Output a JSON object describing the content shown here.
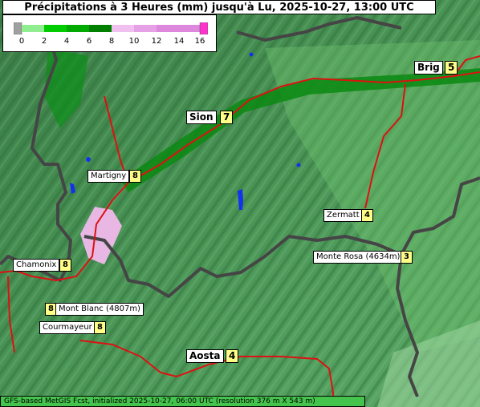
{
  "title": "Précipitations à 3 Heures (mm) jusqu'à Lu, 2025-10-27, 13:00 UTC",
  "legend": {
    "ticks": [
      "0",
      "2",
      "4",
      "6",
      "8",
      "10",
      "12",
      "14",
      "16"
    ],
    "colors": [
      "#a0a0a0",
      "#90ee90",
      "#00cc00",
      "#00aa00",
      "#008000",
      "#f0c0f0",
      "#e6a0e6",
      "#dd88dd",
      "#ff33cc"
    ]
  },
  "locations": [
    {
      "name": "Brig",
      "value": "5"
    },
    {
      "name": "Sion",
      "value": "7"
    },
    {
      "name": "Martigny",
      "value": "8"
    },
    {
      "name": "Zermatt",
      "value": "4"
    },
    {
      "name": "Chamonix",
      "value": "8"
    },
    {
      "name": "Monte Rosa (4634m)",
      "value": "3"
    },
    {
      "name": "Mont Blanc (4807m)",
      "value": "8"
    },
    {
      "name": "Courmayeur",
      "value": "8"
    },
    {
      "name": "Aosta",
      "value": "4"
    }
  ],
  "footer": "GFS-based MetGIS Fcst, initialized 2025-10-27, 06:00 UTC  (resolution 376 m X 543 m)",
  "colors": {
    "terrain": "#3f8a4c",
    "border": "#444444",
    "road": "#dd1111",
    "water": "#1133ee",
    "label_value_bg": "#ffff88"
  }
}
